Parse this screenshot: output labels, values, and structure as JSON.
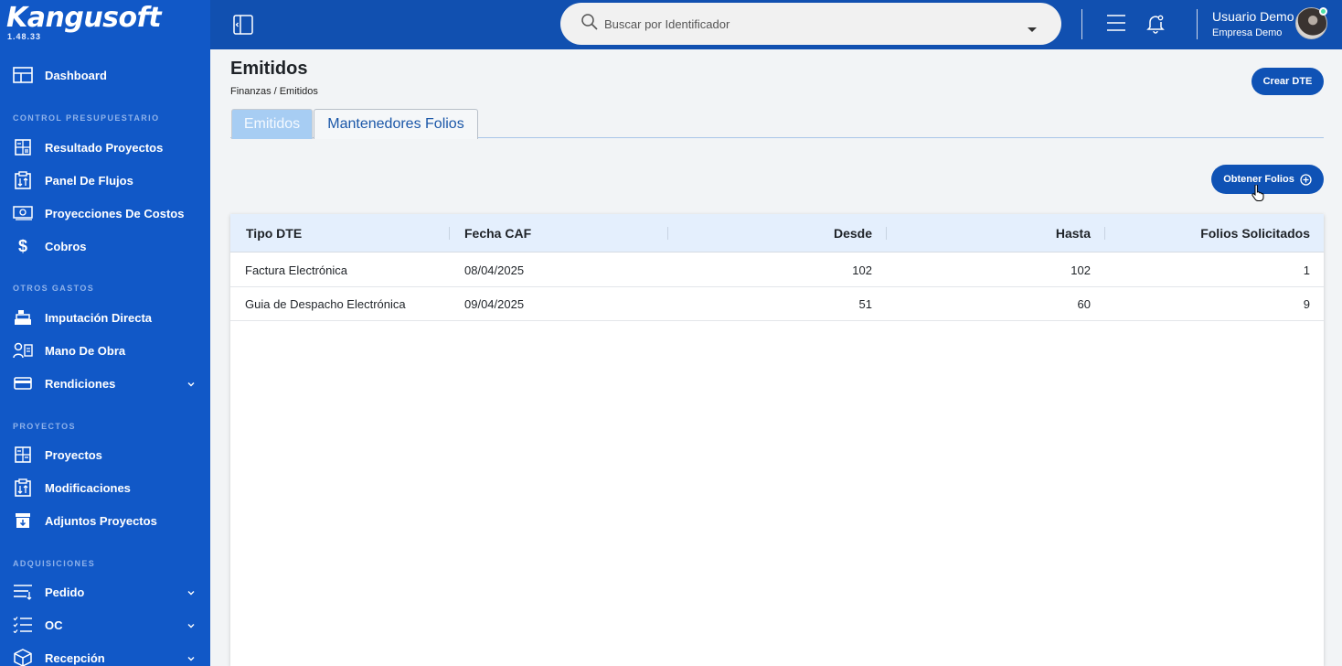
{
  "app": {
    "logo": "Kangusoft",
    "version": "1.48.33"
  },
  "sidebar": {
    "dashboard": "Dashboard",
    "sections": {
      "control": "CONTROL PRESUPUESTARIO",
      "otros": "OTROS GASTOS",
      "proyectos": "PROYECTOS",
      "adquisiciones": "ADQUISICIONES"
    },
    "items": {
      "resultado": "Resultado Proyectos",
      "panel": "Panel De Flujos",
      "proyecciones": "Proyecciones De Costos",
      "cobros": "Cobros",
      "imputacion": "Imputación Directa",
      "mano": "Mano De Obra",
      "rendiciones": "Rendiciones",
      "proyectos": "Proyectos",
      "modificaciones": "Modificaciones",
      "adjuntos": "Adjuntos Proyectos",
      "pedido": "Pedido",
      "oc": "OC",
      "recepcion": "Recepción"
    }
  },
  "topbar": {
    "search_placeholder": "Buscar por Identificador",
    "user_name": "Usuario Demo",
    "user_company": "Empresa Demo"
  },
  "page": {
    "title": "Emitidos",
    "breadcrumb": {
      "parent": "Finanzas",
      "separator": "/",
      "current": "Emitidos"
    },
    "create_button": "Crear DTE",
    "tabs": [
      {
        "label": "Emitidos"
      },
      {
        "label": "Mantenedores Folios"
      }
    ],
    "obtain_button": "Obtener Folios"
  },
  "table": {
    "headers": {
      "tipo": "Tipo DTE",
      "fecha": "Fecha CAF",
      "desde": "Desde",
      "hasta": "Hasta",
      "folios": "Folios Solicitados"
    },
    "rows": [
      {
        "tipo": "Factura Electrónica",
        "fecha": "08/04/2025",
        "desde": "102",
        "hasta": "102",
        "folios": "1"
      },
      {
        "tipo": "Guia de Despacho Electrónica",
        "fecha": "09/04/2025",
        "desde": "51",
        "hasta": "60",
        "folios": "9"
      }
    ]
  },
  "colors": {
    "sidebar": "#1158c7",
    "topbar": "#1150b0",
    "primary_button": "#0f52b5",
    "table_header": "#e4effd",
    "active_tab": "#a7cdf3"
  }
}
